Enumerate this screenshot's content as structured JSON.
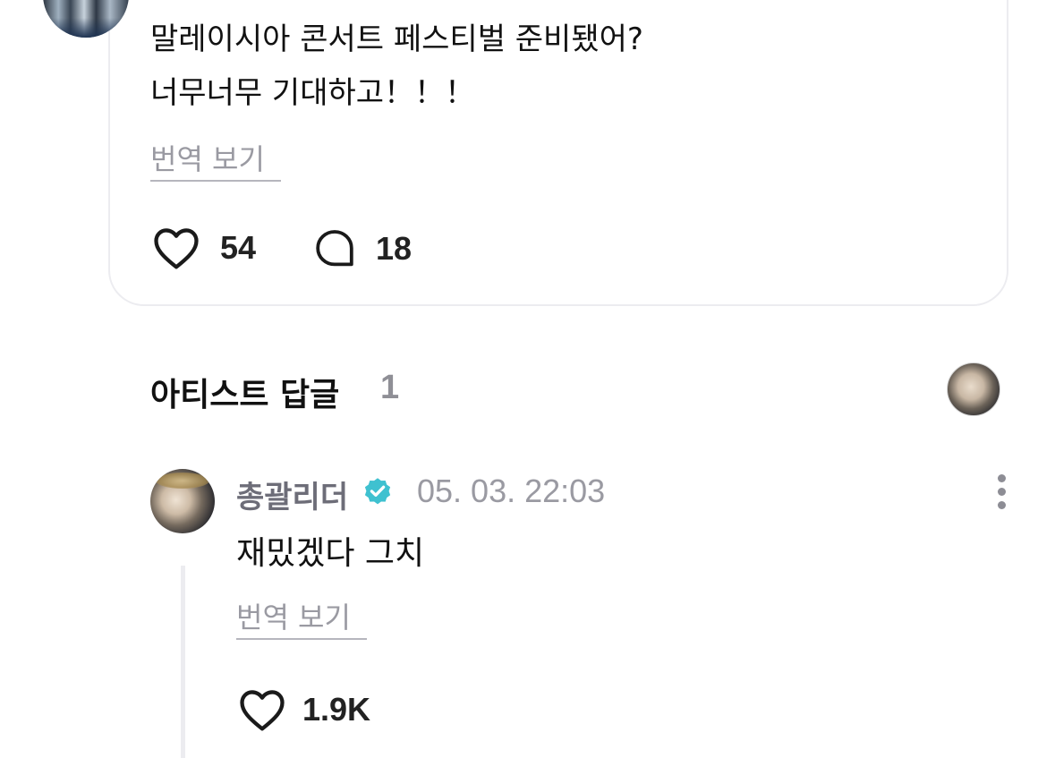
{
  "post": {
    "line1": "말레이시아 콘서트 페스티벌 준비됐어?",
    "line2": "너무너무 기대하고！！！",
    "translate_label": "번역 보기",
    "likes": "54",
    "comments": "18"
  },
  "artist_replies": {
    "title": "아티스트 답글",
    "count": "1"
  },
  "reply": {
    "author": "총괄리더",
    "timestamp": "05. 03. 22:03",
    "text": "재밌겠다 그치",
    "translate_label": "번역 보기",
    "likes": "1.9K"
  },
  "colors": {
    "verified": "#3fc1d0",
    "muted_text": "#9a9aa2",
    "border": "#ececf0"
  }
}
